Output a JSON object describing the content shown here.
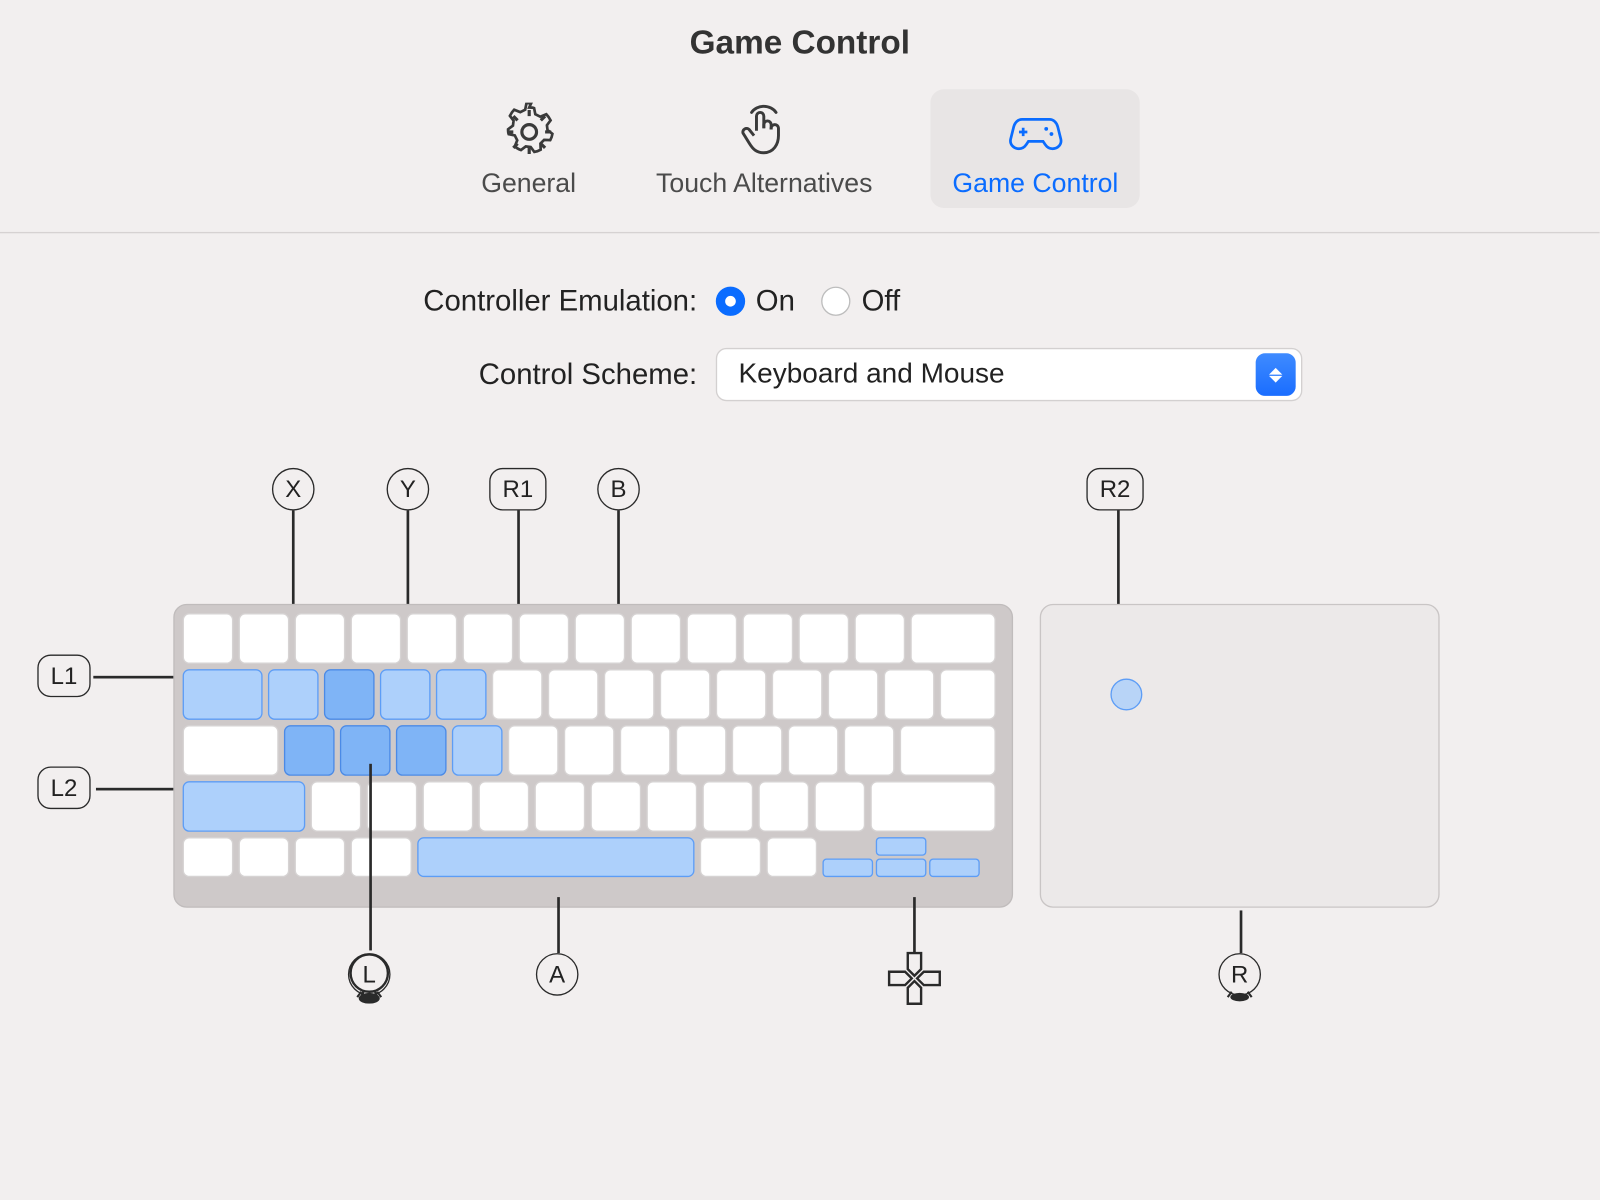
{
  "title": "Game Control",
  "tabs": [
    {
      "label": "General"
    },
    {
      "label": "Touch Alternatives"
    },
    {
      "label": "Game Control"
    }
  ],
  "activeTab": 2,
  "settings": {
    "emulation": {
      "label": "Controller Emulation:",
      "on_label": "On",
      "off_label": "Off",
      "value": "On"
    },
    "scheme": {
      "label": "Control Scheme:",
      "selected": "Keyboard and Mouse"
    }
  },
  "callouts": {
    "X": "X",
    "Y": "Y",
    "R1": "R1",
    "B": "B",
    "R2": "R2",
    "L1": "L1",
    "L2": "L2",
    "L": "L",
    "A": "A",
    "R": "R"
  }
}
